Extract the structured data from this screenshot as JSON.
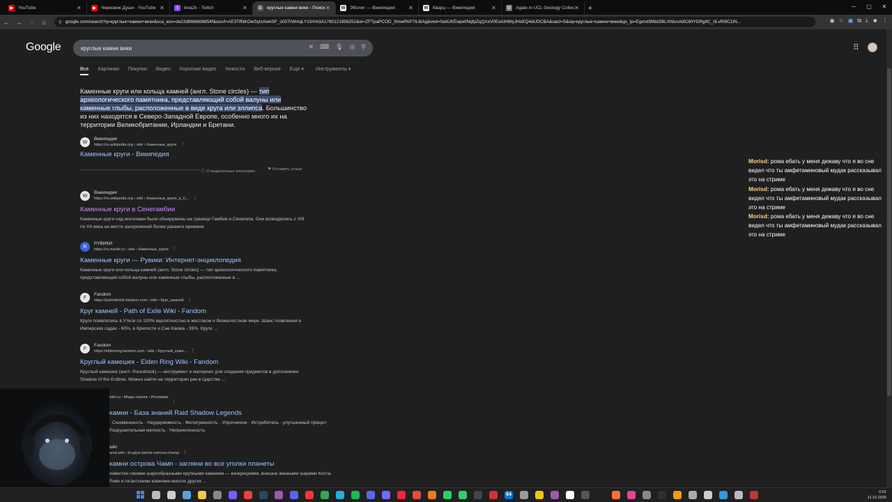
{
  "browser": {
    "tabs": [
      {
        "title": "YouTube",
        "icon": "youtube-icon",
        "color": "#ff0000",
        "glyph": "▶",
        "active": false
      },
      {
        "title": "Черновик Души - YouTube",
        "icon": "youtube-icon",
        "color": "#ff0000",
        "glyph": "▶",
        "active": false
      },
      {
        "title": "leva2k - Twitch",
        "icon": "twitch-icon",
        "color": "#9146ff",
        "glyph": "t",
        "active": false
      },
      {
        "title": "круглые камни вики - Поиск в",
        "icon": "google-icon",
        "color": "#555555",
        "glyph": "G",
        "active": true
      },
      {
        "title": "Эболит — Википедия",
        "icon": "wikipedia-icon",
        "color": "#eeeeee",
        "glyph": "W",
        "active": false
      },
      {
        "title": "Кварц — Википедия",
        "icon": "wikipedia-icon",
        "color": "#eeeeee",
        "glyph": "W",
        "active": false
      },
      {
        "title": "Agate in UCL Geology Collectio",
        "icon": "ucl-icon",
        "color": "#777777",
        "glyph": "U",
        "active": false
      }
    ],
    "new_tab": "+",
    "url": "google.com/search?q=круглые+камни+вики&sca_esv=de22d866bfd6854f&sxsrf=AE3TifNKOwSytzAiehSF_o05TrWmqLY10A%3A1760121956252&ei=ZFTpaPCOD_SmwPAP7IL6iAg&ved=0ahUKEwjw0NqfpZqQAxV0ExAIHWyJHoEQ4dUDCBA&uact=5&oq=круглые+камни+вики&gs_lp=Egxnd3Mtd2l6LXNlcnAiltC60YDRg9C_0LvRi9C1IN..."
  },
  "google": {
    "logo": "Google",
    "query": "круглые камни вики",
    "filters": [
      "Все",
      "Картинки",
      "Покупки",
      "Видео",
      "Короткие видео",
      "Новости",
      "Веб-версия",
      "Ещё ▾",
      "Инструменты ▾"
    ]
  },
  "featured": {
    "text_pre": "Каменные круги или кольца камней (англ. Stone circles) — ",
    "text_hl": "тип археологического памятника, представляющий собой валуны или каменные глыбы, расположенные в виде круга или эллипса",
    "text_post": ". Большинство из них находятся в Северо-Западной Европе, особенно много их на территории Великобритании, Ирландии и Бретани.",
    "source_name": "Википедия",
    "source_url": "https://ru.wikipedia.org › wiki › Каменные_круги",
    "link": "Каменные круги - Википедия",
    "feedback_about": "О выделенных описаниях",
    "feedback_leave": "Оставить отзыв"
  },
  "results": [
    {
      "site": "Википедия",
      "url": "https://ru.wikipedia.org › wiki › Каменные_круги_в_С...",
      "title": "Каменные круги в Сенегамбии",
      "visited": true,
      "icon": "W",
      "snippet": "Каменные круги над могилами были обнаружены на границе Гамбии и Сенегала. Они возводились с VIII по XII века на месте захоронений более раннего времени."
    },
    {
      "site": "РУВИКИ",
      "url": "https://ru.ruwiki.ru › wiki › Каменные_круги",
      "title": "Каменные круги — Рувики: Интернет-энциклопедия",
      "visited": false,
      "icon": "R",
      "snippet": "Каменные круги или кольца камней (англ. Stone circles) — тип археологического памятника, представляющий собой валуны или каменные глыбы, расположенные в ..."
    },
    {
      "site": "Fandom",
      "url": "https://pathofexile.fandom.com › wiki › Круг_камней",
      "title": "Круг камней - Path of Exile Wiki - Fandom",
      "visited": false,
      "icon": "F",
      "snippet": "Круги появлялись в Утесе со 100% вероятностью в жестоком и безжалостном мире. Шанс появления в Имперских садах - 60%, в Крепости и Сне Каома - 35%. Круги ..."
    },
    {
      "site": "Fandom",
      "url": "https://eldenring.fandom.com › wiki › Круглый_каме...",
      "title": "Круглый камешек - Elden Ring Wiki - Fandom",
      "visited": false,
      "icon": "F",
      "snippet": "Круглый камешек (англ. Roundrock) — инструмент и материал для создания предметов в дополнении Shadow of the Erdtree. Можно найти на территории рек в Царстве ..."
    },
    {
      "site": "",
      "url": "wiki.ru › Моды героев › Реликвии",
      "title": "камни - База знаний Raid Shadow Legends",
      "visited": false,
      "icon": "",
      "snippet": "· Снижвенность · Неудержимость · Филигранность · Упрочнение · Истребитель · улучшенный прицел · Разрушительная меткость · Непреклонность."
    },
    {
      "site": "wiki",
      "url": "unst.wiki › kruglye-kamni-ostrova-champ",
      "title": "камни острова Чамп - загляни во все уголки планеты",
      "visited": false,
      "icon": "",
      "snippet": "известен своими шарообразными крупными камнями — конкрециями, внешне женными шарами Коста-Рики и гигантскими камнями многих других ..."
    }
  ],
  "chat": [
    {
      "user": "Morisd:",
      "text": "рома ебать у меня дежаву что я во сне видел что ты амфетаминовый мудак рассказывал это на стриме"
    },
    {
      "user": "Morisd:",
      "text": "рома ебать у меня дежаву что я во сне видел что ты амфетаминовый мудак рассказывал это на стриме"
    },
    {
      "user": "Morisd:",
      "text": "рома ебать у меня дежаву что я во сне видел что ты амфетаминовый мудак рассказывал это на стриме"
    }
  ],
  "taskbar": {
    "time": "0:01",
    "date": "11.10.2025",
    "badge": "64"
  },
  "colors": {
    "link": "#99c3ff",
    "visited": "#c58af9",
    "highlight": "#3c4a69",
    "chat_user": "#ffd28a"
  }
}
